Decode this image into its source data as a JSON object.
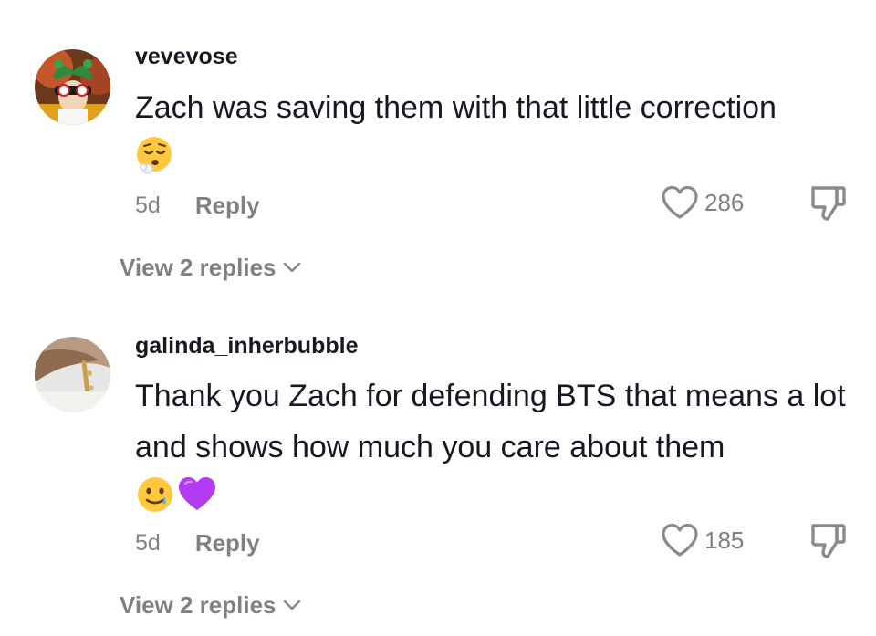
{
  "comments": [
    {
      "username": "vevevose",
      "text": "Zach was saving them with that little correction",
      "emojis": [
        "sighing-face-emoji"
      ],
      "time": "5d",
      "reply_label": "Reply",
      "likes": "286",
      "view_replies_label": "View 2 replies"
    },
    {
      "username": "galinda_inherbubble",
      "text": "Thank you Zach for defending BTS that means a lot and shows how much you care about them",
      "emojis": [
        "smiling-face-with-tear-emoji",
        "purple-heart-emoji"
      ],
      "time": "5d",
      "reply_label": "Reply",
      "likes": "185",
      "view_replies_label": "View 2 replies"
    }
  ],
  "icons": {
    "like": "heart-outline-icon",
    "dislike": "thumbs-down-icon",
    "expand": "chevron-down-icon"
  },
  "colors": {
    "text_primary": "#161823",
    "text_secondary": "#8a8b91",
    "purple_heart": "#b33bf2"
  }
}
